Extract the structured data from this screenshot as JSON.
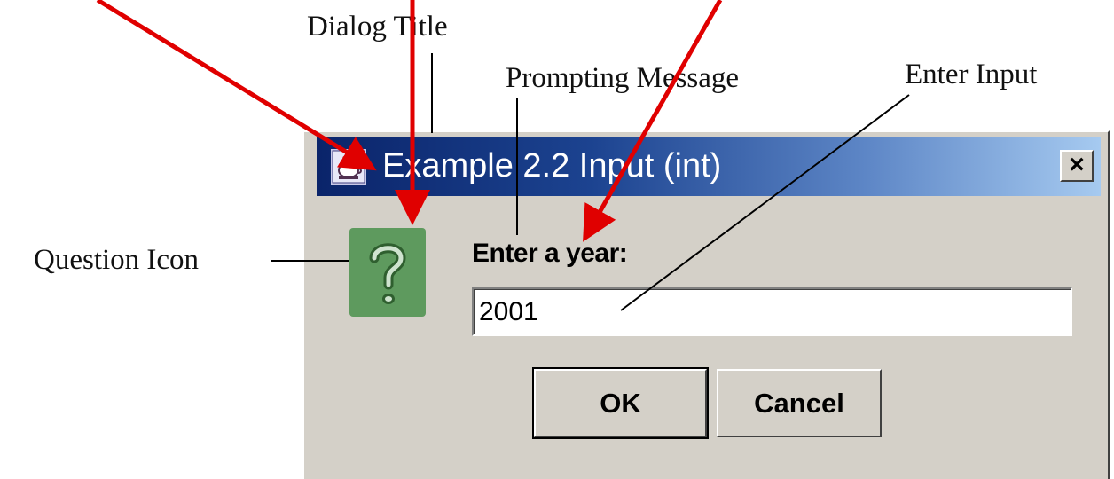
{
  "annotations": {
    "dialog_title": "Dialog Title",
    "prompting_message": "Prompting Message",
    "enter_input": "Enter Input",
    "question_icon": "Question Icon"
  },
  "dialog": {
    "title": "Example 2.2 Input (int)",
    "close_label": "×",
    "prompt": "Enter a year:",
    "input_value": "2001",
    "buttons": {
      "ok": "OK",
      "cancel": "Cancel"
    },
    "icon": "question-icon"
  },
  "colors": {
    "titlebar_start": "#0a246a",
    "titlebar_end": "#a6caf0",
    "dialog_background": "#d4d0c8",
    "question_icon_background": "#5e9a5e",
    "arrow": "#e00000",
    "leader_line": "#000000"
  }
}
